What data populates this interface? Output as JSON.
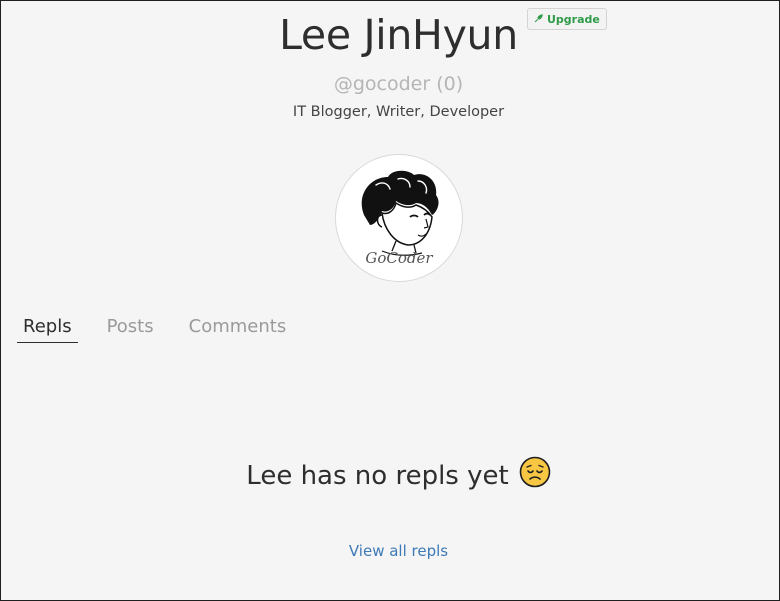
{
  "profile": {
    "name": "Lee JinHyun",
    "upgrade_label": "Upgrade",
    "handle": "@gocoder (0)",
    "bio": "IT Blogger, Writer, Developer",
    "avatar_text": "GoCoder"
  },
  "tabs": [
    {
      "label": "Repls",
      "active": true
    },
    {
      "label": "Posts",
      "active": false
    },
    {
      "label": "Comments",
      "active": false
    }
  ],
  "empty_state": {
    "message": "Lee has no repls yet",
    "emoji": "pensive-face-icon"
  },
  "view_all_label": "View all repls",
  "colors": {
    "background": "#f5f5f5",
    "text": "#2e2e2e",
    "muted": "#9a9a9a",
    "link": "#3d7ab8",
    "upgrade_green": "#2f9b4a"
  }
}
